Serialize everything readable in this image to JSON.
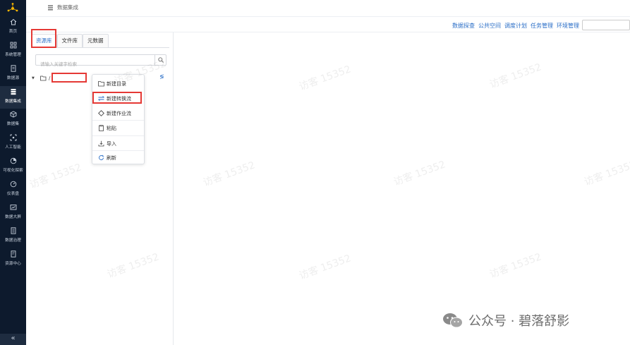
{
  "nav": {
    "items": [
      {
        "label": "首页",
        "icon": "home-icon"
      },
      {
        "label": "系统管理",
        "icon": "grid-icon"
      },
      {
        "label": "数据源",
        "icon": "document-icon"
      },
      {
        "label": "数据集成",
        "icon": "database-icon",
        "active": true
      },
      {
        "label": "数据集",
        "icon": "cube-icon"
      },
      {
        "label": "人工智能",
        "icon": "scan-icon"
      },
      {
        "label": "可视化探索",
        "icon": "pie-icon"
      },
      {
        "label": "仪表盘",
        "icon": "gauge-icon"
      },
      {
        "label": "数据大屏",
        "icon": "chart-screen-icon"
      },
      {
        "label": "数据治理",
        "icon": "list-icon"
      },
      {
        "label": "资源中心",
        "icon": "book-icon"
      }
    ],
    "collapse": "«"
  },
  "header": {
    "title": "数据集成"
  },
  "toplinks": [
    "数据探查",
    "公共空间",
    "调度计划",
    "任务管理",
    "环境管理"
  ],
  "tabs": [
    "资源库",
    "文件库",
    "元数据"
  ],
  "search": {
    "placeholder": "请输入关键字检索"
  },
  "tree": {
    "caret": "▼",
    "slash": "/"
  },
  "panel_action": "≶",
  "context_menu": [
    {
      "label": "新建目录",
      "icon": "folder-icon"
    },
    {
      "label": "新建转换流",
      "icon": "transform-icon"
    },
    {
      "label": "新建作业流",
      "icon": "diamond-icon"
    },
    {
      "label": "粘贴",
      "icon": "paste-icon"
    },
    {
      "label": "导入",
      "icon": "import-icon"
    },
    {
      "label": "刷新",
      "icon": "refresh-icon"
    }
  ],
  "watermark": "访客 15352",
  "brand": "公众号 · 碧落舒影",
  "colors": {
    "nav_bg": "#0d1a2d",
    "accent": "#2a6ec7",
    "highlight": "#e53935"
  }
}
